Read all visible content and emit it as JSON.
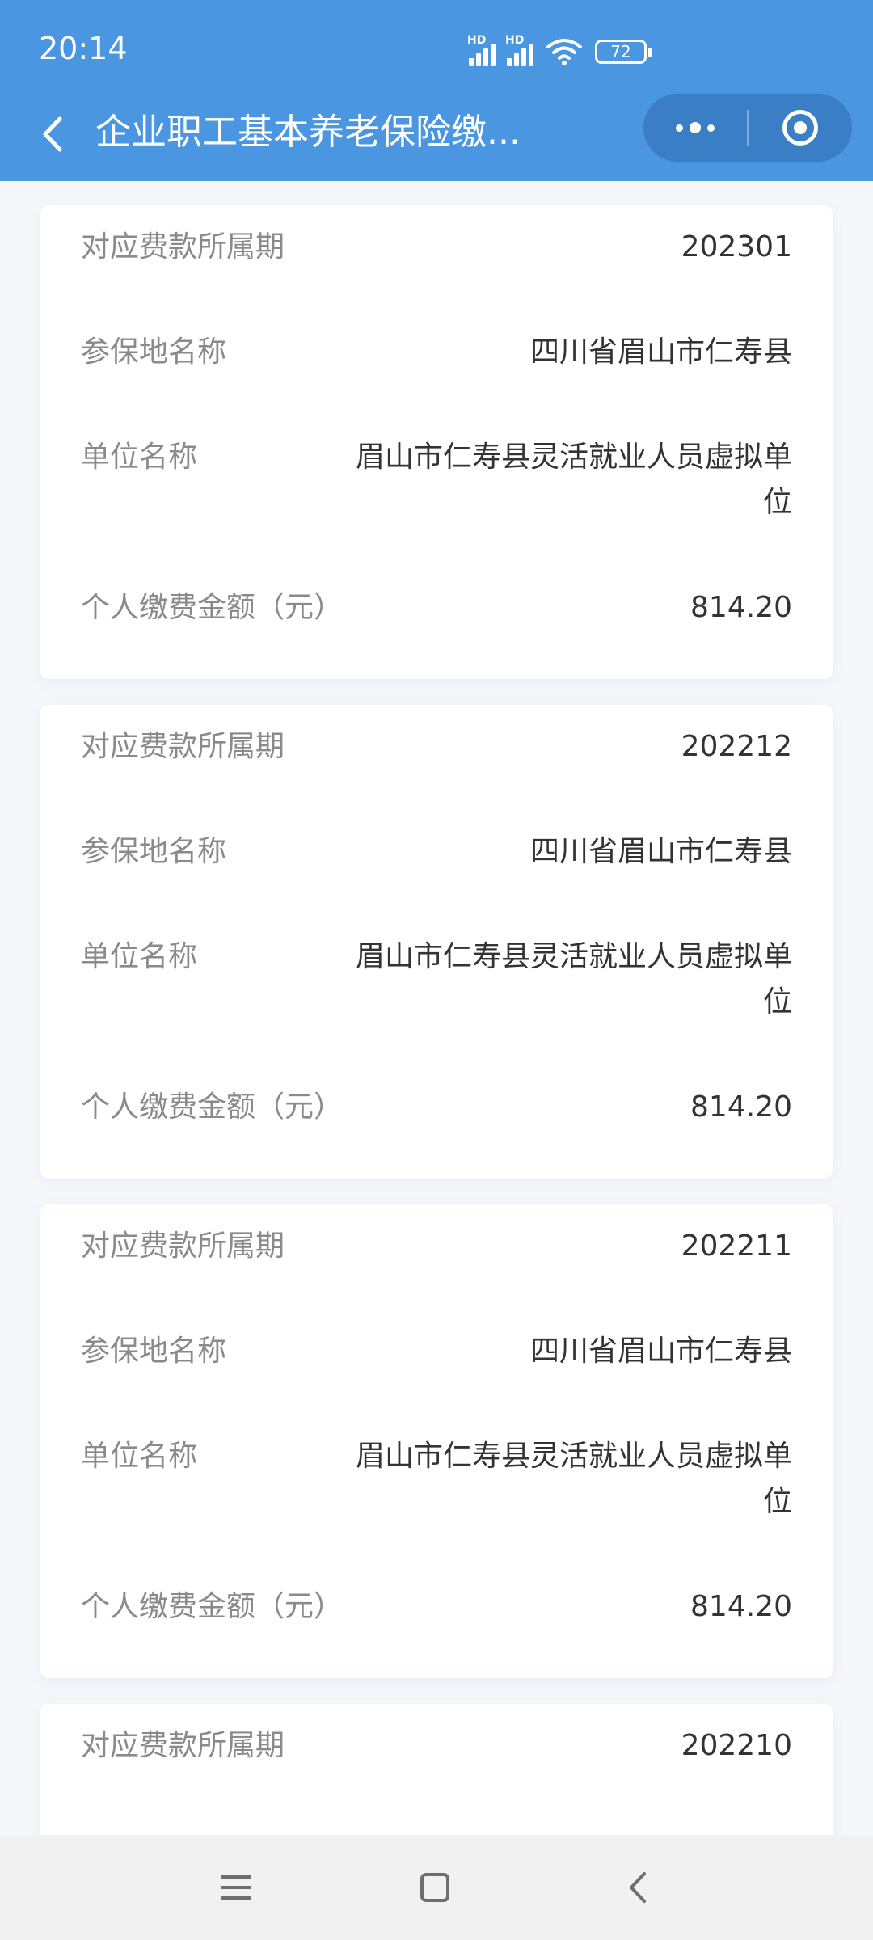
{
  "status_bar": {
    "time": "20:14",
    "battery": "72",
    "signal_badge": "HD"
  },
  "nav": {
    "title": "企业职工基本养老保险缴...",
    "accent_color": "#4b96e0"
  },
  "icons": {
    "back": "back-icon",
    "more": "more-icon",
    "close": "close-target-icon",
    "menu": "menu-icon",
    "home": "home-icon",
    "nav_back": "nav-back-icon"
  },
  "records": [
    {
      "period_label": "对应费款所属期",
      "period": "202301",
      "place_label": "参保地名称",
      "place": "四川省眉山市仁寿县",
      "unit_label": "单位名称",
      "unit": "眉山市仁寿县灵活就业人员虚拟单位",
      "amount_label": "个人缴费金额（元）",
      "amount": "814.20"
    },
    {
      "period_label": "对应费款所属期",
      "period": "202212",
      "place_label": "参保地名称",
      "place": "四川省眉山市仁寿县",
      "unit_label": "单位名称",
      "unit": "眉山市仁寿县灵活就业人员虚拟单位",
      "amount_label": "个人缴费金额（元）",
      "amount": "814.20"
    },
    {
      "period_label": "对应费款所属期",
      "period": "202211",
      "place_label": "参保地名称",
      "place": "四川省眉山市仁寿县",
      "unit_label": "单位名称",
      "unit": "眉山市仁寿县灵活就业人员虚拟单位",
      "amount_label": "个人缴费金额（元）",
      "amount": "814.20"
    },
    {
      "period_label": "对应费款所属期",
      "period": "202210"
    }
  ]
}
